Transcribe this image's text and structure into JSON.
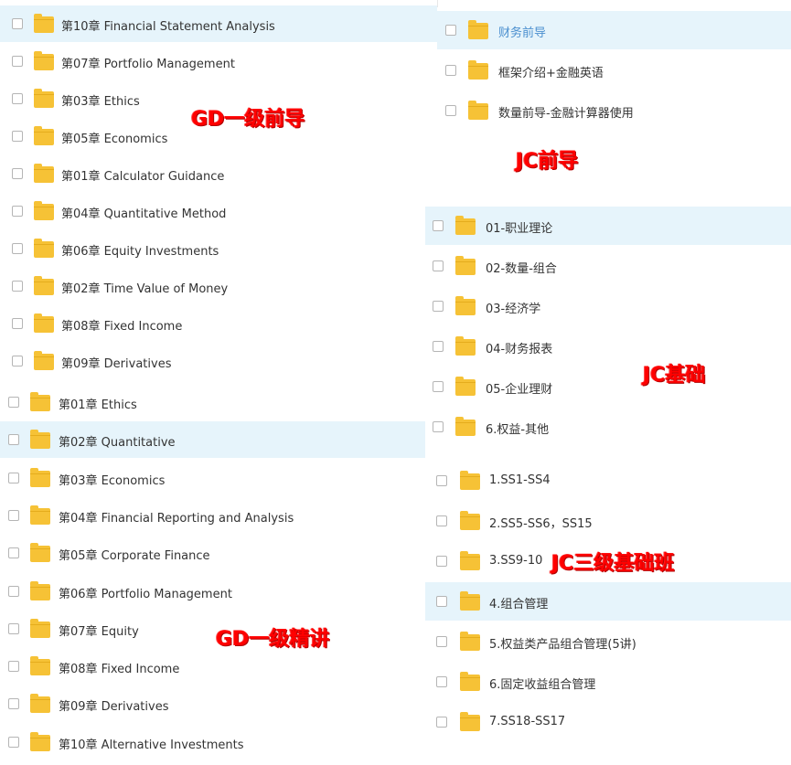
{
  "gd_qiandao": {
    "tag": "GD一级前导",
    "items": [
      {
        "label": "第10章 Financial Statement Analysis",
        "selected": true
      },
      {
        "label": "第07章 Portfolio Management",
        "selected": false
      },
      {
        "label": "第03章 Ethics",
        "selected": false
      },
      {
        "label": "第05章 Economics",
        "selected": false
      },
      {
        "label": "第01章 Calculator Guidance",
        "selected": false
      },
      {
        "label": "第04章 Quantitative Method",
        "selected": false
      },
      {
        "label": "第06章 Equity Investments",
        "selected": false
      },
      {
        "label": "第02章 Time Value of Money",
        "selected": false
      },
      {
        "label": "第08章 Fixed Income",
        "selected": false
      },
      {
        "label": "第09章 Derivatives",
        "selected": false
      }
    ]
  },
  "gd_jingjiang": {
    "tag": "GD一级精讲",
    "items": [
      {
        "label": "第01章 Ethics",
        "selected": false
      },
      {
        "label": "第02章 Quantitative",
        "selected": true
      },
      {
        "label": "第03章 Economics",
        "selected": false
      },
      {
        "label": "第04章 Financial Reporting and Analysis",
        "selected": false
      },
      {
        "label": "第05章 Corporate Finance",
        "selected": false
      },
      {
        "label": "第06章 Portfolio Management",
        "selected": false
      },
      {
        "label": "第07章 Equity",
        "selected": false
      },
      {
        "label": "第08章 Fixed Income",
        "selected": false
      },
      {
        "label": "第09章 Derivatives",
        "selected": false
      },
      {
        "label": "第10章 Alternative Investments",
        "selected": false
      }
    ]
  },
  "jc_qiandao": {
    "tag": "JC前导",
    "items": [
      {
        "label": "财务前导",
        "selected": true
      },
      {
        "label": "框架介绍+金融英语",
        "selected": false
      },
      {
        "label": "数量前导-金融计算器使用",
        "selected": false
      }
    ]
  },
  "jc_jichu": {
    "tag": "JC基础",
    "items": [
      {
        "label": "01-职业理论",
        "selected": true
      },
      {
        "label": "02-数量-组合",
        "selected": false
      },
      {
        "label": "03-经济学",
        "selected": false
      },
      {
        "label": "04-财务报表",
        "selected": false
      },
      {
        "label": "05-企业理财",
        "selected": false
      },
      {
        "label": "6.权益-其他",
        "selected": false
      }
    ]
  },
  "jc_sanji": {
    "tag": "JC三级基础班",
    "items": [
      {
        "label": "1.SS1-SS4",
        "selected": false
      },
      {
        "label": "2.SS5-SS6，SS15",
        "selected": false
      },
      {
        "label": "3.SS9-10",
        "selected": false
      },
      {
        "label": "4.组合管理",
        "selected": true
      },
      {
        "label": "5.权益类产品组合管理(5讲)",
        "selected": false
      },
      {
        "label": "6.固定收益组合管理",
        "selected": false
      },
      {
        "label": "7.SS18-SS17",
        "selected": false
      }
    ]
  },
  "colors": {
    "folder": "#f6c236",
    "selected_row": "#e6f4fb",
    "tag_red": "#ff0000",
    "link_blue": "#4a8fcf"
  },
  "icons": {
    "folder": "folder-icon",
    "checkbox": "checkbox"
  }
}
